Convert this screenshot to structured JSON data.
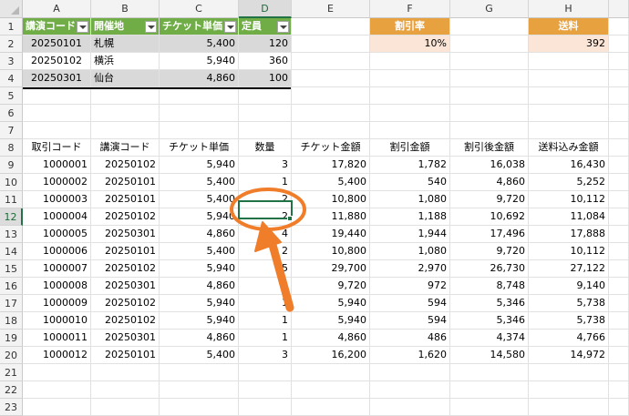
{
  "columns": [
    "A",
    "B",
    "C",
    "D",
    "E",
    "F",
    "G",
    "H"
  ],
  "rows": [
    "1",
    "2",
    "3",
    "4",
    "5",
    "6",
    "7",
    "8",
    "9",
    "10",
    "11",
    "12",
    "13",
    "14",
    "15",
    "16",
    "17",
    "18",
    "19",
    "20",
    "21",
    "22",
    "23"
  ],
  "table1": {
    "headers": [
      "講演コード",
      "開催地",
      "チケット単価",
      "定員"
    ],
    "rows": [
      [
        "20250101",
        "札幌",
        "5,400",
        "120"
      ],
      [
        "20250102",
        "横浜",
        "5,940",
        "360"
      ],
      [
        "20250301",
        "仙台",
        "4,860",
        "100"
      ]
    ]
  },
  "discount": {
    "label": "割引率",
    "value": "10%"
  },
  "shipping": {
    "label": "送料",
    "value": "392"
  },
  "orders": {
    "headers": [
      "取引コード",
      "講演コード",
      "チケット単価",
      "数量",
      "チケット金額",
      "割引金額",
      "割引後金額",
      "送料込み金額"
    ],
    "rows": [
      [
        "1000001",
        "20250102",
        "5,940",
        "3",
        "17,820",
        "1,782",
        "16,038",
        "16,430"
      ],
      [
        "1000002",
        "20250101",
        "5,400",
        "1",
        "5,400",
        "540",
        "4,860",
        "5,252"
      ],
      [
        "1000003",
        "20250101",
        "5,400",
        "2",
        "10,800",
        "1,080",
        "9,720",
        "10,112"
      ],
      [
        "1000004",
        "20250102",
        "5,940",
        "2",
        "11,880",
        "1,188",
        "10,692",
        "11,084"
      ],
      [
        "1000005",
        "20250301",
        "4,860",
        "4",
        "19,440",
        "1,944",
        "17,496",
        "17,888"
      ],
      [
        "1000006",
        "20250101",
        "5,400",
        "2",
        "10,800",
        "1,080",
        "9,720",
        "10,112"
      ],
      [
        "1000007",
        "20250102",
        "5,940",
        "5",
        "29,700",
        "2,970",
        "26,730",
        "27,122"
      ],
      [
        "1000008",
        "20250301",
        "4,860",
        "2",
        "9,720",
        "972",
        "8,748",
        "9,140"
      ],
      [
        "1000009",
        "20250102",
        "5,940",
        "1",
        "5,940",
        "594",
        "5,346",
        "5,738"
      ],
      [
        "1000010",
        "20250102",
        "5,940",
        "1",
        "5,940",
        "594",
        "5,346",
        "5,738"
      ],
      [
        "1000011",
        "20250301",
        "4,860",
        "1",
        "4,860",
        "486",
        "4,374",
        "4,766"
      ],
      [
        "1000012",
        "20250101",
        "5,400",
        "3",
        "16,200",
        "1,620",
        "14,580",
        "14,972"
      ]
    ]
  },
  "active_cell": {
    "column": "D",
    "row": "12",
    "value": "2"
  },
  "colors": {
    "table_header": "#70ad47",
    "band": "#d9d9d9",
    "orange_header": "#e7a13f",
    "peach": "#fbe5d6",
    "annotation": "#f07d2a",
    "selection": "#217346"
  }
}
